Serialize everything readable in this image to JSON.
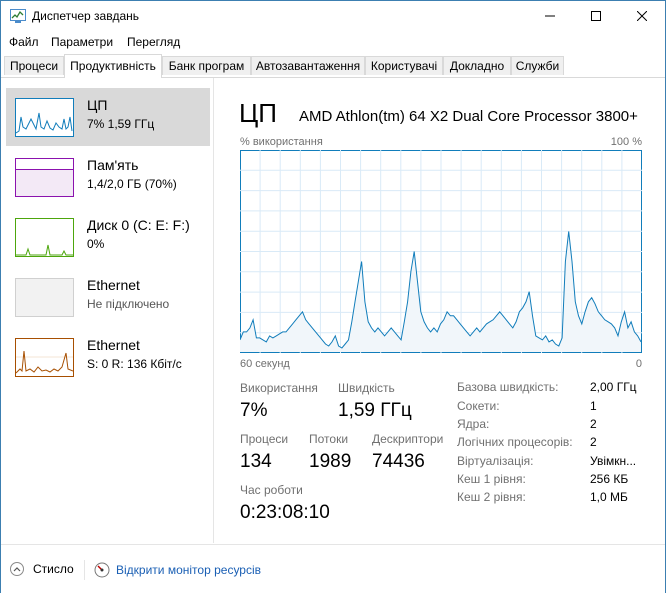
{
  "window": {
    "title": "Диспетчер завдань"
  },
  "menu": [
    "Файл",
    "Параметри",
    "Перегляд"
  ],
  "tabs": [
    "Процеси",
    "Продуктивність",
    "Банк програм",
    "Автозавантаження",
    "Користувачі",
    "Докладно",
    "Служби"
  ],
  "sidebar": [
    {
      "name": "ЦП",
      "sub": "7%  1,59 ГГц",
      "color": "#117dbb"
    },
    {
      "name": "Пам'ять",
      "sub": "1,4/2,0 ГБ (70%)",
      "color": "#8b12ae"
    },
    {
      "name": "Диск 0 (C: E: F:)",
      "sub": "0%",
      "color": "#4da60c"
    },
    {
      "name": "Ethernet",
      "sub": "Не підключено",
      "color": "#a0a0a0"
    },
    {
      "name": "Ethernet",
      "sub": "S: 0 R: 136 Кбіт/с",
      "color": "#a74f01"
    }
  ],
  "main": {
    "title": "ЦП",
    "cpu_name": "AMD Athlon(tm) 64 X2 Dual Core Processor 3800+",
    "graph_label": "% використання",
    "graph_max": "100 %",
    "x_left": "60 секунд",
    "x_right": "0",
    "stats": {
      "usage_label": "Використання",
      "usage_value": "7%",
      "speed_label": "Швидкість",
      "speed_value": "1,59 ГГц",
      "processes_label": "Процеси",
      "processes_value": "134",
      "threads_label": "Потоки",
      "threads_value": "1989",
      "handles_label": "Дескриптори",
      "handles_value": "74436",
      "uptime_label": "Час роботи",
      "uptime_value": "0:23:08:10"
    },
    "details": [
      {
        "label": "Базова швидкість:",
        "value": "2,00 ГГц"
      },
      {
        "label": "Сокети:",
        "value": "1"
      },
      {
        "label": "Ядра:",
        "value": "2"
      },
      {
        "label": "Логічних процесорів:",
        "value": "2"
      },
      {
        "label": "Віртуалізація:",
        "value": "Увімкн..."
      },
      {
        "label": "Кеш 1 рівня:",
        "value": "256 КБ"
      },
      {
        "label": "Кеш 2 рівня:",
        "value": "1,0 МБ"
      }
    ]
  },
  "footer": {
    "less": "Стисло",
    "monitor": "Відкрити монітор ресурсів"
  },
  "chart_data": {
    "type": "area",
    "ylim": [
      0,
      100
    ],
    "values": [
      6,
      10,
      10,
      12,
      16,
      7,
      7,
      6,
      5,
      8,
      7,
      8,
      9,
      10,
      10,
      12,
      14,
      16,
      18,
      20,
      16,
      14,
      12,
      10,
      8,
      6,
      4,
      3,
      5,
      8,
      3,
      2,
      4,
      6,
      15,
      25,
      35,
      45,
      25,
      15,
      12,
      10,
      12,
      10,
      8,
      10,
      12,
      10,
      8,
      6,
      15,
      25,
      40,
      50,
      35,
      20,
      15,
      12,
      10,
      12,
      10,
      14,
      16,
      20,
      18,
      18,
      16,
      14,
      12,
      10,
      8,
      10,
      12,
      10,
      12,
      14,
      15,
      16,
      18,
      20,
      18,
      16,
      14,
      12,
      15,
      20,
      22,
      25,
      30,
      18,
      8,
      7,
      6,
      8,
      5,
      6,
      4,
      3,
      7,
      45,
      60,
      45,
      25,
      18,
      14,
      20,
      25,
      27,
      24,
      20,
      18,
      16,
      15,
      14,
      12,
      8,
      15,
      20,
      12,
      15,
      10,
      8,
      5
    ]
  }
}
